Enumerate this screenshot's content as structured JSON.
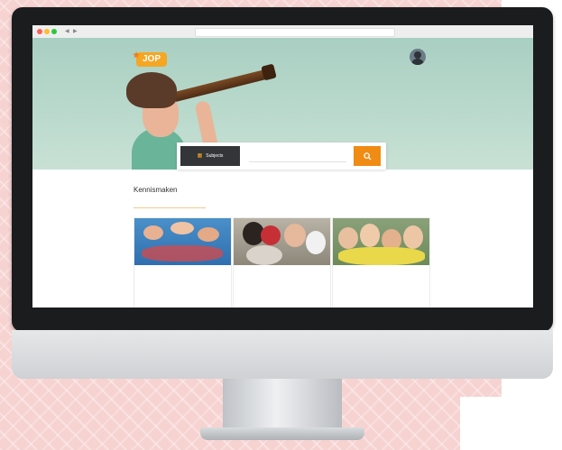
{
  "colors": {
    "accent": "#f08b13",
    "logo": "#f5a623",
    "dark_button": "#333538",
    "hero_bg": "#b9d9cc",
    "background": "#f6d3d1"
  },
  "browser": {
    "url": ""
  },
  "header": {
    "logo_text": "JOP",
    "nav": [
      "",
      "",
      "",
      "",
      "",
      ""
    ],
    "avatar_icon": "user-avatar-icon"
  },
  "search": {
    "category_label": "Subjects",
    "category_icon": "grid-icon",
    "placeholder": "",
    "button_icon": "search-icon"
  },
  "main": {
    "section_title": "Kennismaken",
    "section_subtitle": "",
    "cards": [
      {
        "meta1": "",
        "meta2": "",
        "title": "",
        "count": ""
      },
      {
        "meta1": "",
        "meta2": "",
        "title": "",
        "count": ""
      },
      {
        "meta1": "",
        "meta2": "",
        "title": "",
        "count": ""
      }
    ]
  }
}
